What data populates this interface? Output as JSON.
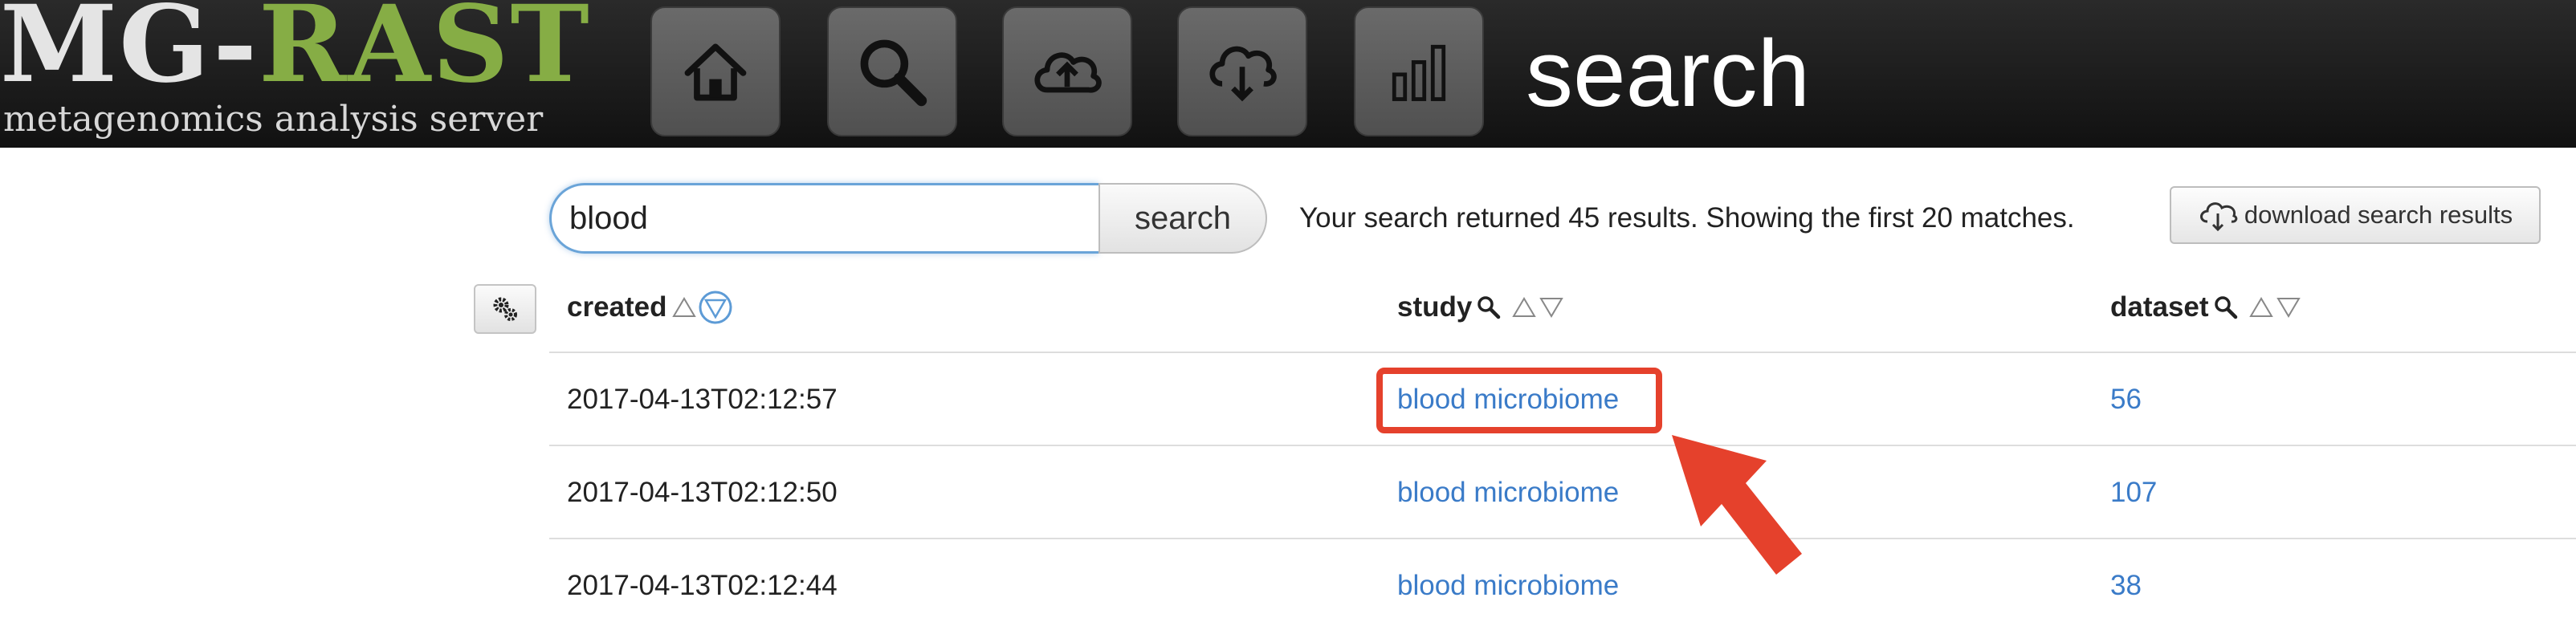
{
  "header": {
    "logo_main": "MG-",
    "logo_accent": "RAST",
    "logo_subtitle": "metagenomics analysis server",
    "page_title": "search",
    "nav_icons": [
      "home-icon",
      "search-icon",
      "upload-cloud-icon",
      "download-cloud-icon",
      "bar-chart-icon"
    ],
    "accent_color": "#86ad45"
  },
  "search": {
    "query": "blood",
    "button_label": "search",
    "summary": "Your search returned 45 results. Showing the first 20 matches.",
    "download_label": "download search results"
  },
  "table": {
    "columns": [
      {
        "label": "created",
        "sort": "descending"
      },
      {
        "label": "study",
        "searchable": true
      },
      {
        "label": "dataset",
        "searchable": true
      }
    ],
    "rows": [
      {
        "created": "2017-04-13T02:12:57",
        "study": "blood microbiome",
        "dataset": "56"
      },
      {
        "created": "2017-04-13T02:12:50",
        "study": "blood microbiome",
        "dataset": "107"
      },
      {
        "created": "2017-04-13T02:12:44",
        "study": "blood microbiome",
        "dataset": "38"
      }
    ],
    "link_color": "#3a7bc8"
  },
  "annotation": {
    "highlight_color": "#e5412c"
  }
}
